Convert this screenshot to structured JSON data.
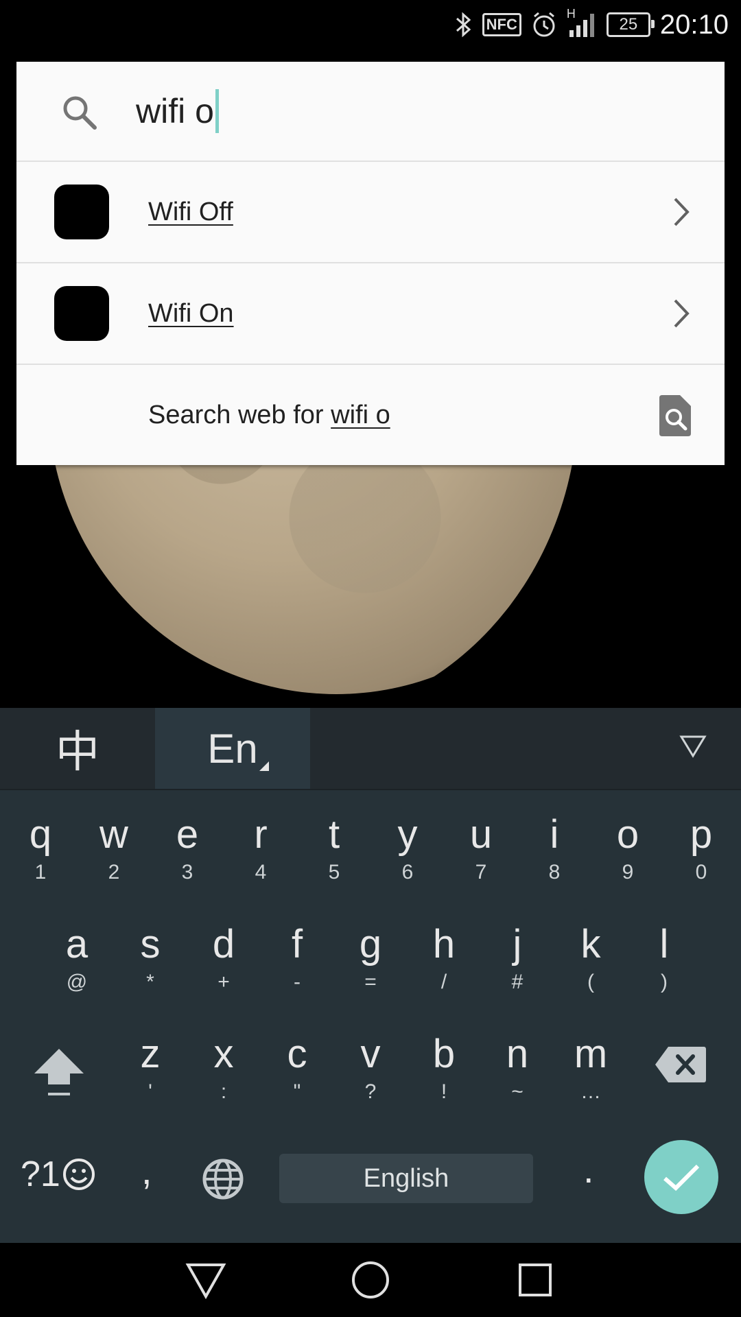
{
  "status_bar": {
    "time": "20:10",
    "battery": "25",
    "nfc_label": "NFC",
    "network_type": "H",
    "icons": [
      "bluetooth-icon",
      "nfc-icon",
      "alarm-icon",
      "signal-icon",
      "battery-icon"
    ]
  },
  "search": {
    "query": "wifi o",
    "results": [
      {
        "label": "Wifi Off"
      },
      {
        "label": "Wifi On"
      }
    ],
    "web_search_prefix": "Search web for ",
    "web_search_query": "wifi o"
  },
  "keyboard": {
    "tabs": {
      "chinese": "中",
      "english": "En"
    },
    "row1": [
      {
        "main": "q",
        "sub": "1"
      },
      {
        "main": "w",
        "sub": "2"
      },
      {
        "main": "e",
        "sub": "3"
      },
      {
        "main": "r",
        "sub": "4"
      },
      {
        "main": "t",
        "sub": "5"
      },
      {
        "main": "y",
        "sub": "6"
      },
      {
        "main": "u",
        "sub": "7"
      },
      {
        "main": "i",
        "sub": "8"
      },
      {
        "main": "o",
        "sub": "9"
      },
      {
        "main": "p",
        "sub": "0"
      }
    ],
    "row2": [
      {
        "main": "a",
        "sub": "@"
      },
      {
        "main": "s",
        "sub": "*"
      },
      {
        "main": "d",
        "sub": "+"
      },
      {
        "main": "f",
        "sub": "-"
      },
      {
        "main": "g",
        "sub": "="
      },
      {
        "main": "h",
        "sub": "/"
      },
      {
        "main": "j",
        "sub": "#"
      },
      {
        "main": "k",
        "sub": "("
      },
      {
        "main": "l",
        "sub": ")"
      }
    ],
    "row3": [
      {
        "main": "z",
        "sub": "'"
      },
      {
        "main": "x",
        "sub": ":"
      },
      {
        "main": "c",
        "sub": "\""
      },
      {
        "main": "v",
        "sub": "?"
      },
      {
        "main": "b",
        "sub": "!"
      },
      {
        "main": "n",
        "sub": "~"
      },
      {
        "main": "m",
        "sub": "…"
      }
    ],
    "symbols_label": "?1",
    "comma": ",",
    "period": ".",
    "space_label": "English"
  },
  "colors": {
    "accent": "#7fd0c7",
    "keyboard_bg": "#263238",
    "panel_bg": "#fafafa"
  }
}
